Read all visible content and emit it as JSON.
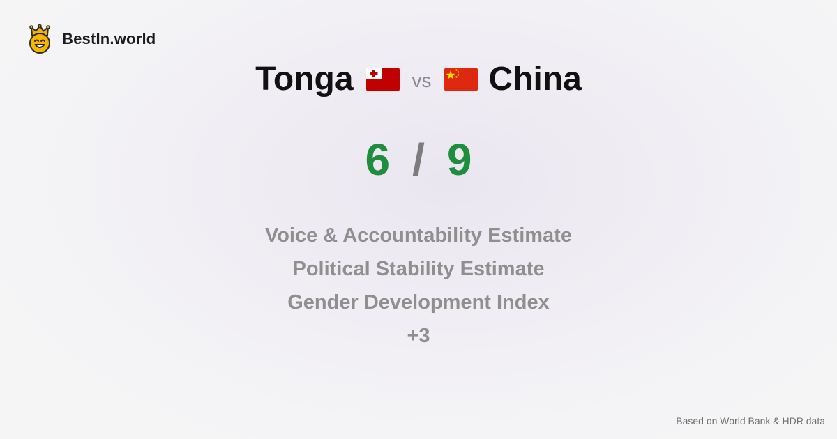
{
  "brand": {
    "name": "BestIn.world",
    "logo_icon": "crown-smiley-icon"
  },
  "comparison": {
    "left": {
      "name": "Tonga",
      "flag_icon": "tonga-flag-icon",
      "score": "6"
    },
    "vs_label": "vs",
    "right": {
      "name": "China",
      "flag_icon": "china-flag-icon",
      "score": "9"
    },
    "separator": "/",
    "score_color": "#1e8e3e"
  },
  "metrics": [
    "Voice & Accountability Estimate",
    "Political Stability Estimate",
    "Gender Development Index"
  ],
  "more_label": "+3",
  "footer": {
    "source_note": "Based on World Bank & HDR data"
  }
}
